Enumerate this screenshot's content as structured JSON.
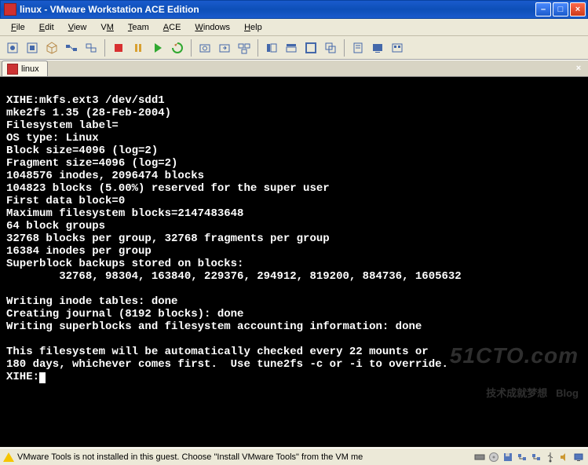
{
  "titlebar": {
    "title": "linux - VMware Workstation ACE Edition"
  },
  "menu": {
    "file": "File",
    "edit": "Edit",
    "view": "View",
    "vm": "VM",
    "team": "Team",
    "ace": "ACE",
    "windows": "Windows",
    "help": "Help"
  },
  "tab": {
    "label": "linux",
    "close": "×"
  },
  "terminal": {
    "lines": [
      "XIHE:mkfs.ext3 /dev/sdd1",
      "mke2fs 1.35 (28-Feb-2004)",
      "Filesystem label=",
      "OS type: Linux",
      "Block size=4096 (log=2)",
      "Fragment size=4096 (log=2)",
      "1048576 inodes, 2096474 blocks",
      "104823 blocks (5.00%) reserved for the super user",
      "First data block=0",
      "Maximum filesystem blocks=2147483648",
      "64 block groups",
      "32768 blocks per group, 32768 fragments per group",
      "16384 inodes per group",
      "Superblock backups stored on blocks:",
      "        32768, 98304, 163840, 229376, 294912, 819200, 884736, 1605632",
      "",
      "Writing inode tables: done",
      "Creating journal (8192 blocks): done",
      "Writing superblocks and filesystem accounting information: done",
      "",
      "This filesystem will be automatically checked every 22 mounts or",
      "180 days, whichever comes first.  Use tune2fs -c or -i to override."
    ],
    "prompt": "XIHE:"
  },
  "statusbar": {
    "message": "VMware Tools is not installed in this guest. Choose \"Install VMware Tools\" from the VM me"
  },
  "watermark": {
    "line1": "51CTO.com",
    "line2": "技术成就梦想   Blog"
  }
}
